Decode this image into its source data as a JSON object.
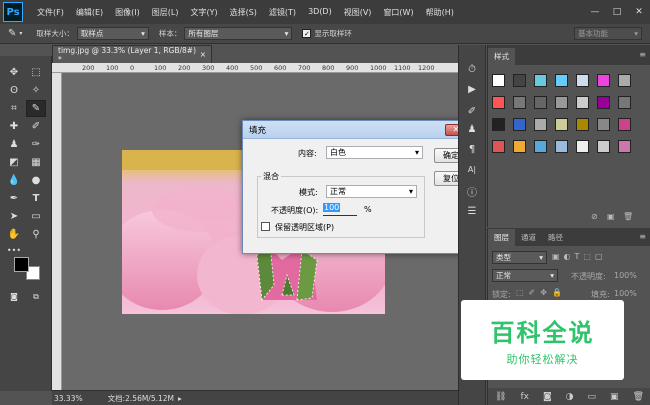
{
  "app": {
    "logo": "Ps"
  },
  "menu": [
    "文件(F)",
    "编辑(E)",
    "图像(I)",
    "图层(L)",
    "文字(Y)",
    "选择(S)",
    "滤镜(T)",
    "3D(D)",
    "视图(V)",
    "窗口(W)",
    "帮助(H)"
  ],
  "window_controls": {
    "minimize": "—",
    "maximize": "□",
    "close": "✕"
  },
  "options_bar": {
    "sample_size_label": "取样大小：",
    "sample_size_value": "取样点",
    "sample_label": "样本：",
    "sample_value": "所有图层",
    "show_ring_label": "显示取样环",
    "workspace": "基本功能"
  },
  "document": {
    "tab_title": "timg.jpg @ 33.3% (Layer 1, RGB/8#) *",
    "tab_close": "×",
    "zoom": "33.33%",
    "doc_info": "文档:2.56M/5.12M",
    "ruler_ticks": [
      "200",
      "100",
      "0",
      "100",
      "200",
      "300",
      "400",
      "500",
      "600",
      "700",
      "800",
      "900",
      "1000",
      "1100",
      "1200"
    ]
  },
  "dialog": {
    "title": "填充",
    "close": "✕",
    "content_label": "内容:",
    "content_value": "白色",
    "ok": "确定",
    "reset": "复位",
    "blend_group": "混合",
    "mode_label": "模式:",
    "mode_value": "正常",
    "opacity_label": "不透明度(O):",
    "opacity_value": "100",
    "opacity_unit": "%",
    "preserve_label": "保留透明区域(P)"
  },
  "styles_panel": {
    "tab": "样式"
  },
  "layers_panel": {
    "tabs": [
      "图层",
      "通道",
      "路径"
    ],
    "kind_label": "类型",
    "blend_mode": "正常",
    "opacity_label": "不透明度:",
    "opacity_value": "100%",
    "lock_label": "锁定:",
    "fill_label": "填充:",
    "fill_value": "100%"
  },
  "watermark": {
    "title": "百科全说",
    "subtitle": "助你轻松解决"
  },
  "colors": {
    "accent": "#31a8ff",
    "watermark_green": "#2fc46b",
    "dialog_title": "#b9d1ee"
  }
}
